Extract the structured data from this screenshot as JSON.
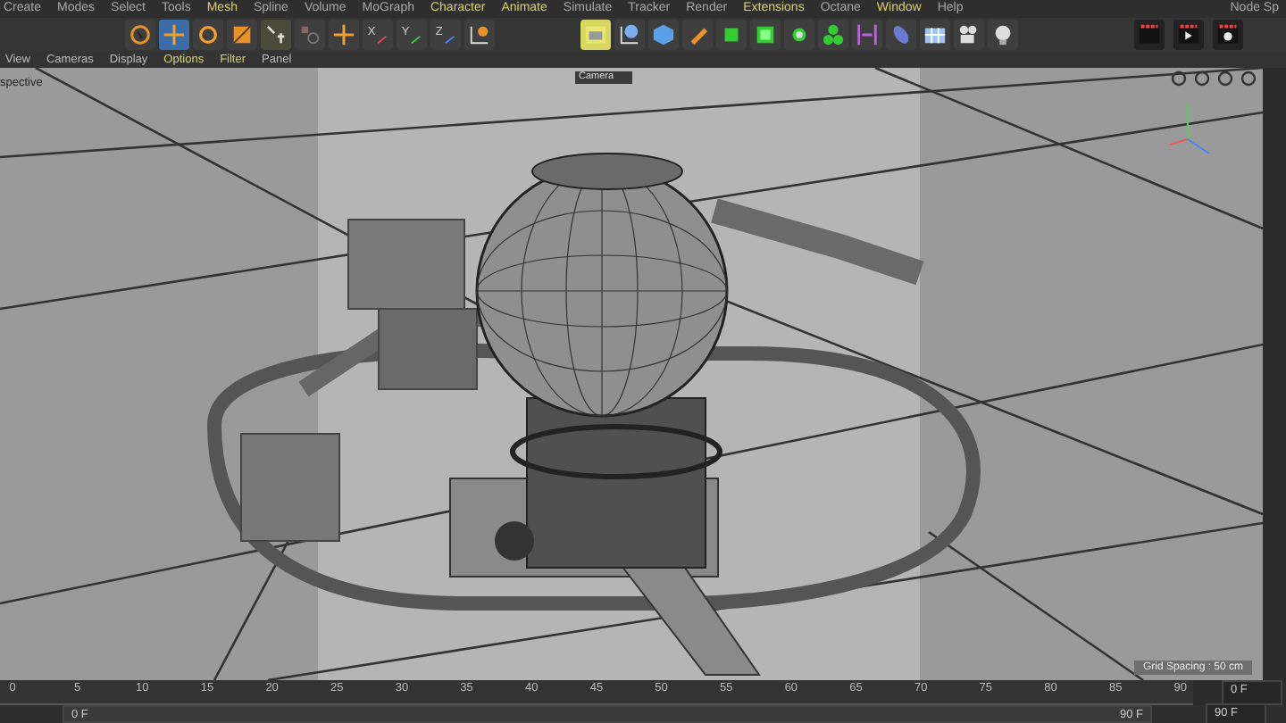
{
  "menu_bar": [
    {
      "label": "Create",
      "highlighted": false
    },
    {
      "label": "Modes",
      "highlighted": false
    },
    {
      "label": "Select",
      "highlighted": false
    },
    {
      "label": "Tools",
      "highlighted": false
    },
    {
      "label": "Mesh",
      "highlighted": true
    },
    {
      "label": "Spline",
      "highlighted": false
    },
    {
      "label": "Volume",
      "highlighted": false
    },
    {
      "label": "MoGraph",
      "highlighted": false
    },
    {
      "label": "Character",
      "highlighted": true
    },
    {
      "label": "Animate",
      "highlighted": true
    },
    {
      "label": "Simulate",
      "highlighted": false
    },
    {
      "label": "Tracker",
      "highlighted": false
    },
    {
      "label": "Render",
      "highlighted": false
    },
    {
      "label": "Extensions",
      "highlighted": true
    },
    {
      "label": "Octane",
      "highlighted": false
    },
    {
      "label": "Window",
      "highlighted": true
    },
    {
      "label": "Help",
      "highlighted": false
    }
  ],
  "menu_bar_right": "Node Sp",
  "axis_buttons": [
    "X",
    "Y",
    "Z"
  ],
  "viewport_menu": [
    {
      "label": "View",
      "highlighted": false
    },
    {
      "label": "Cameras",
      "highlighted": false
    },
    {
      "label": "Display",
      "highlighted": false
    },
    {
      "label": "Options",
      "highlighted": true
    },
    {
      "label": "Filter",
      "highlighted": true
    },
    {
      "label": "Panel",
      "highlighted": false
    }
  ],
  "viewport": {
    "view_name": "spective",
    "camera": "Camera",
    "grid_spacing": "Grid Spacing : 50 cm"
  },
  "timeline": {
    "ticks": [
      "0",
      "5",
      "10",
      "15",
      "20",
      "25",
      "30",
      "35",
      "40",
      "45",
      "50",
      "55",
      "60",
      "65",
      "70",
      "75",
      "80",
      "85",
      "90"
    ],
    "end_marker": "90 F"
  },
  "frame_fields": {
    "preview_start": "0 F",
    "current": "0 F",
    "end": "90 F"
  },
  "preview_range": {
    "level": 1
  }
}
